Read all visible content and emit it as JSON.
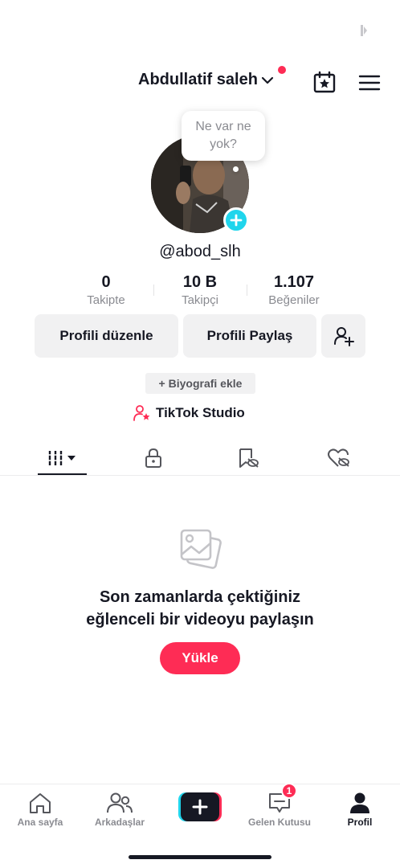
{
  "header": {
    "username": "Abdullatif saleh",
    "has_notification": true
  },
  "profile": {
    "bubble_text": "Ne var ne yok?",
    "handle": "@abod_slh"
  },
  "stats": [
    {
      "value": "0",
      "label": "Takipte"
    },
    {
      "value": "10 B",
      "label": "Takipçi"
    },
    {
      "value": "1.107",
      "label": "Beğeniler"
    }
  ],
  "actions": {
    "edit_profile": "Profili düzenle",
    "share_profile": "Profili Paylaş"
  },
  "bio_button": "+ Biyografi ekle",
  "studio": "TikTok Studio",
  "tabs": [
    "videos-icon",
    "lock-icon",
    "eye-slash-icon",
    "heart-slash-icon"
  ],
  "empty_state": {
    "title": "Son zamanlarda çektiğiniz eğlenceli bir videoyu paylaşın",
    "upload": "Yükle"
  },
  "bottom_nav": {
    "home": "Ana sayfa",
    "friends": "Arkadaşlar",
    "inbox": "Gelen Kutusu",
    "inbox_badge": "1",
    "profile": "Profil"
  },
  "colors": {
    "accent": "#fe2c55",
    "cyan": "#20d5ec",
    "text": "#161823",
    "muted": "#8a8b91",
    "button_bg": "#f1f1f2"
  }
}
